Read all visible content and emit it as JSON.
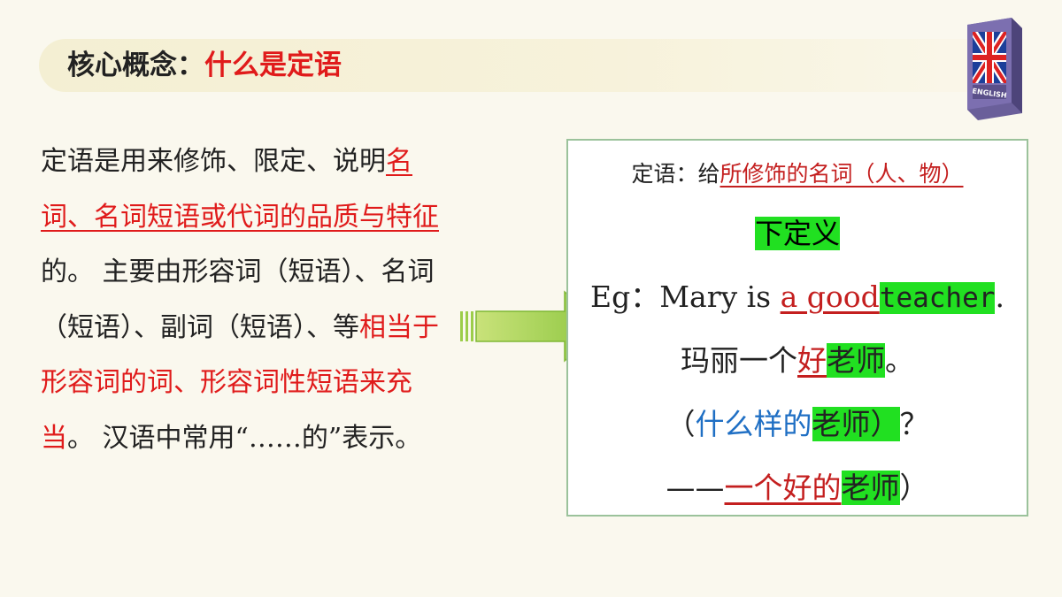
{
  "title": {
    "prefix": "核心概念：",
    "main": "什么是定语"
  },
  "book": {
    "label": "ENGLISH"
  },
  "left": {
    "p1": "定语是用来修饰、限定、说明",
    "p2_red": "名词、名词短语或代词的品质与特征",
    "p3": "的。 主要由形容词（短语）、名词（短语）、副词（短语）、等",
    "p4_red": "相当于形容词的词、形容词性短语来充当",
    "p5": "。 汉语中常用“……的”表示。"
  },
  "box": {
    "line1_a": "定语：给",
    "line1_b": "所修饰的名词（人、物）",
    "line2": "下定义",
    "line3_a": "Eg：Mary is ",
    "line3_b": "a good",
    "line3_c": "teacher",
    "line3_d": ".",
    "line4_a": "玛丽一个",
    "line4_b": "好",
    "line4_c": "老师",
    "line4_d": "。",
    "line5_a": "（",
    "line5_b": "什么样的",
    "line5_c": "老师）",
    "line5_d": "？",
    "line6_a": "——",
    "line6_b": "一个好的",
    "line6_c": "老师",
    "line6_d": "）"
  }
}
